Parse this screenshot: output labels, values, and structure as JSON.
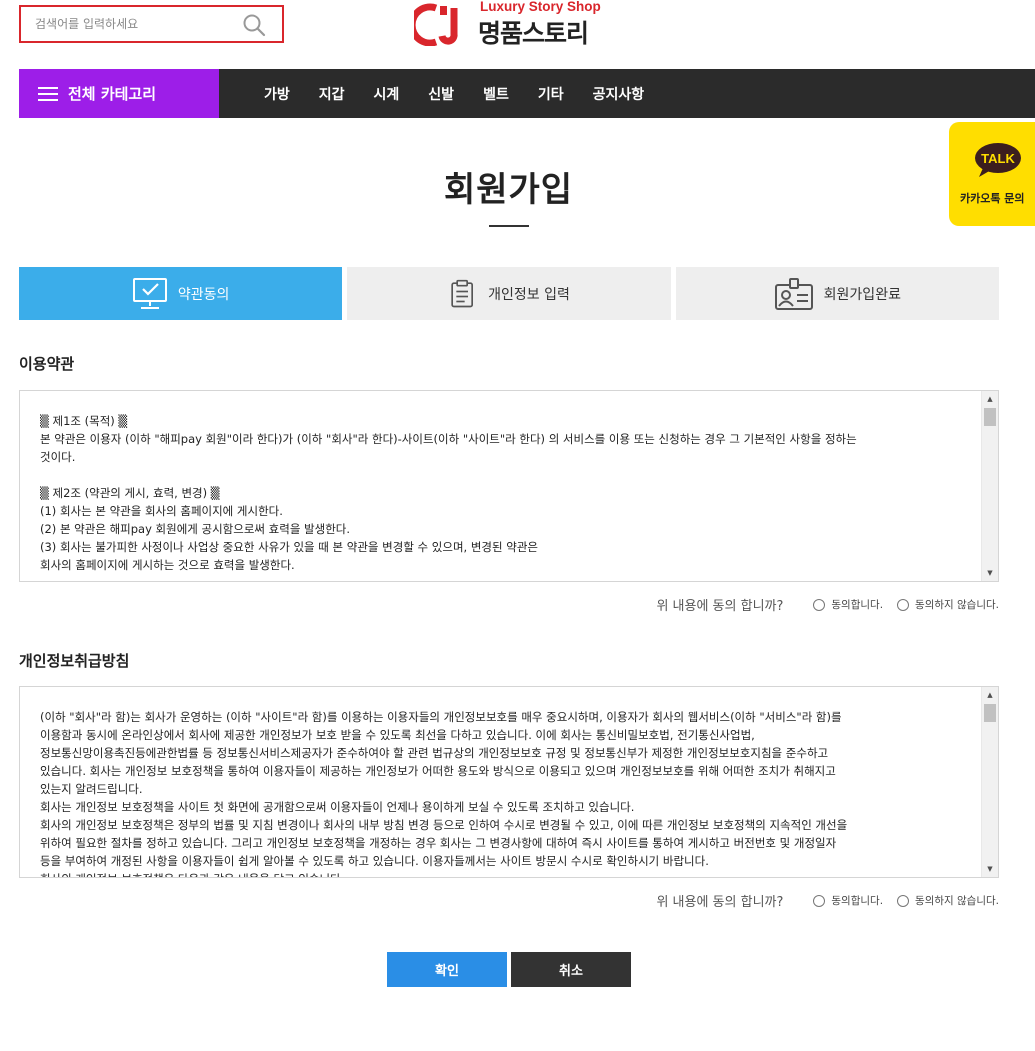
{
  "header": {
    "search_placeholder": "검색어를 입력하세요",
    "logo_en": "Luxury Story Shop",
    "logo_ko": "명품스토리"
  },
  "nav": {
    "category_label": "전체 카테고리",
    "items": [
      "가방",
      "지갑",
      "시계",
      "신발",
      "벨트",
      "기타",
      "공지사항"
    ]
  },
  "kakao": {
    "bubble_text": "TALK",
    "label": "카카오톡 문의"
  },
  "page": {
    "title": "회원가입"
  },
  "steps": [
    {
      "label": "약관동의",
      "icon": "monitor-check-icon",
      "active": true
    },
    {
      "label": "개인정보 입력",
      "icon": "clipboard-icon",
      "active": false
    },
    {
      "label": "회원가입완료",
      "icon": "id-card-icon",
      "active": false
    }
  ],
  "terms": {
    "title": "이용약관",
    "text": "▒ 제1조 (목적) ▒\n본 약관은 이용자 (이하 \"해피pay 회원\"이라 한다)가 (이하 \"회사\"라 한다)-사이트(이하 \"사이트\"라 한다) 의 서비스를 이용 또는 신청하는 경우 그 기본적인 사항을 정하는\n것이다.\n\n▒ 제2조 (약관의 게시, 효력, 변경) ▒\n(1) 회사는 본 약관을 회사의 홈페이지에 게시한다.\n(2) 본 약관은 해피pay 회원에게 공시함으로써 효력을 발생한다.\n(3) 회사는 불가피한 사정이나 사업상 중요한 사유가 있을 때 본 약관을 변경할 수 있으며, 변경된 약관은\n회사의 홈페이지에 게시하는 것으로 효력을 발생한다.",
    "agree_question": "위 내용에 동의 합니까?",
    "agree_label": "동의합니다.",
    "disagree_label": "동의하지 않습니다."
  },
  "privacy": {
    "title": "개인정보취급방침",
    "text": "(이하 \"회사\"라 함)는 회사가 운영하는 (이하 \"사이트\"라 함)를 이용하는 이용자들의 개인정보보호를 매우 중요시하며, 이용자가 회사의 웹서비스(이하 \"서비스\"라 함)를\n이용함과 동시에 온라인상에서 회사에 제공한 개인정보가 보호 받을 수 있도록 최선을 다하고 있습니다. 이에 회사는 통신비밀보호법, 전기통신사업법,\n정보통신망이용촉진등에관한법률 등 정보통신서비스제공자가 준수하여야 할 관련 법규상의 개인정보보호 규정 및 정보통신부가 제정한 개인정보보호지침을 준수하고\n있습니다. 회사는 개인정보 보호정책을 통하여 이용자들이 제공하는 개인정보가 어떠한 용도와 방식으로 이용되고 있으며 개인정보보호를 위해 어떠한 조치가 취해지고\n있는지 알려드립니다.\n회사는 개인정보 보호정책을 사이트 첫 화면에 공개함으로써 이용자들이 언제나 용이하게 보실 수 있도록 조치하고 있습니다.\n회사의 개인정보 보호정책은 정부의 법률 및 지침 변경이나 회사의 내부 방침 변경 등으로 인하여 수시로 변경될 수 있고, 이에 따른 개인정보 보호정책의 지속적인 개선을\n위하여 필요한 절차를 정하고 있습니다. 그리고 개인정보 보호정책을 개정하는 경우 회사는 그 변경사항에 대하여 즉시 사이트를 통하여 게시하고 버전번호 및 개정일자\n등을 부여하여 개정된 사항을 이용자들이 쉽게 알아볼 수 있도록 하고 있습니다. 이용자들께서는 사이트 방문시 수시로 확인하시기 바랍니다.\n회사의 개인정보 보호정책은 다음과 같은 내용을 담고 있습니다.",
    "agree_question": "위 내용에 동의 합니까?",
    "agree_label": "동의합니다.",
    "disagree_label": "동의하지 않습니다."
  },
  "buttons": {
    "confirm": "확인",
    "cancel": "취소"
  },
  "colors": {
    "brand_red": "#d9262c",
    "category_purple": "#9d1ee8",
    "nav_dark": "#2b2b2b",
    "step_active": "#3badea",
    "kakao_yellow": "#ffde00",
    "confirm_blue": "#2a8ee6",
    "cancel_dark": "#333333"
  }
}
